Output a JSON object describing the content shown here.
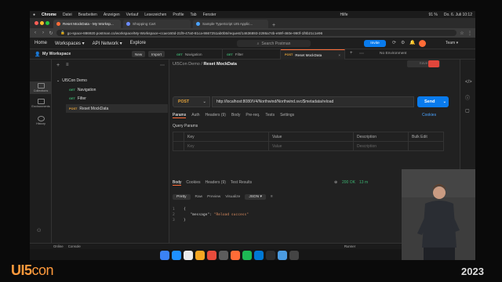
{
  "menubar": {
    "apple": "",
    "items": [
      "Chrome",
      "Datei",
      "Bearbeiten",
      "Anzeigen",
      "Verlauf",
      "Lesezeichen",
      "Profile",
      "Tab",
      "Fenster",
      "Hilfe"
    ],
    "battery": "91 %",
    "clock": "Do. 6. Juli 10:12"
  },
  "chrome_tabs": [
    {
      "title": "Reset MockData - My Worksp...",
      "active": true
    },
    {
      "title": "Shopping Cart",
      "active": false
    },
    {
      "title": "Sample TypeScript UI5 Applic...",
      "active": false
    }
  ],
  "url": "go-space-886920.postman.co/workspace/My-Workspace~ccae160d-21f9-47a0-81ca-8667251ab0b5/request/14636893-2286a74b-e59f-460e-990f-1f8b21c1e96",
  "postman": {
    "nav": [
      "Home",
      "Workspaces ▾",
      "API Network ▾",
      "Explore"
    ],
    "search_placeholder": "Search Postman",
    "invite_label": "Invite",
    "team_label": "Team ▾",
    "workspace_title": "My Workspace",
    "new_label": "New",
    "import_label": "Import",
    "no_env": "No Environment"
  },
  "request_tabs": [
    {
      "method": "GET",
      "name": "Navigation",
      "active": false
    },
    {
      "method": "GET",
      "name": "Filter",
      "active": false
    },
    {
      "method": "POST",
      "name": "Reset MockData",
      "active": true
    }
  ],
  "rail": [
    {
      "label": "Collections",
      "icon": "collections-icon"
    },
    {
      "label": "Environments",
      "icon": "environments-icon"
    },
    {
      "label": "History",
      "icon": "history-icon"
    }
  ],
  "sidebar": {
    "collection": "UI5Con Demo",
    "items": [
      {
        "method": "GET",
        "name": "Navigation"
      },
      {
        "method": "GET",
        "name": "Filter"
      },
      {
        "method": "POST",
        "name": "Reset MockData"
      }
    ]
  },
  "request": {
    "breadcrumb_parent": "UI5Con Demo",
    "breadcrumb_sep": "/",
    "breadcrumb_current": "Reset MockData",
    "save_label": "Save",
    "method": "POST",
    "url": "http://localhost:8080/V4/Northwind/Northwind.svc/$metadata/reload",
    "send_label": "Send",
    "tabs": [
      "Params",
      "Auth",
      "Headers (9)",
      "Body",
      "Pre-req.",
      "Tests",
      "Settings"
    ],
    "cookies_label": "Cookies",
    "query_params_title": "Query Params",
    "table_headers": [
      "Key",
      "Value",
      "Description",
      "Bulk Edit"
    ],
    "row_placeholder": [
      "Key",
      "Value",
      "Description"
    ]
  },
  "response": {
    "tabs": [
      "Body",
      "Cookies",
      "Headers (9)",
      "Test Results"
    ],
    "status": "200 OK",
    "time": "13 m",
    "formats": [
      "Pretty",
      "Raw",
      "Preview",
      "Visualize"
    ],
    "format_select": "JSON ▾",
    "code": [
      {
        "n": "1",
        "text": "{"
      },
      {
        "n": "2",
        "key": "\"message\":",
        "val": "\"Reload success\""
      },
      {
        "n": "3",
        "text": "}"
      }
    ]
  },
  "statusbar": [
    "Online",
    "Console",
    "Runner"
  ],
  "dock_colors": [
    "#3b82f6",
    "#1e90ff",
    "#eaeaea",
    "#f5a623",
    "#e74c3c",
    "#5c5c5c",
    "#ff6c37",
    "#1db954",
    "#0078d4",
    "#2d2d2d",
    "#4b9be0",
    "#444444"
  ],
  "branding": {
    "ui5": "UI5",
    "con": "con",
    "year": "2023"
  }
}
